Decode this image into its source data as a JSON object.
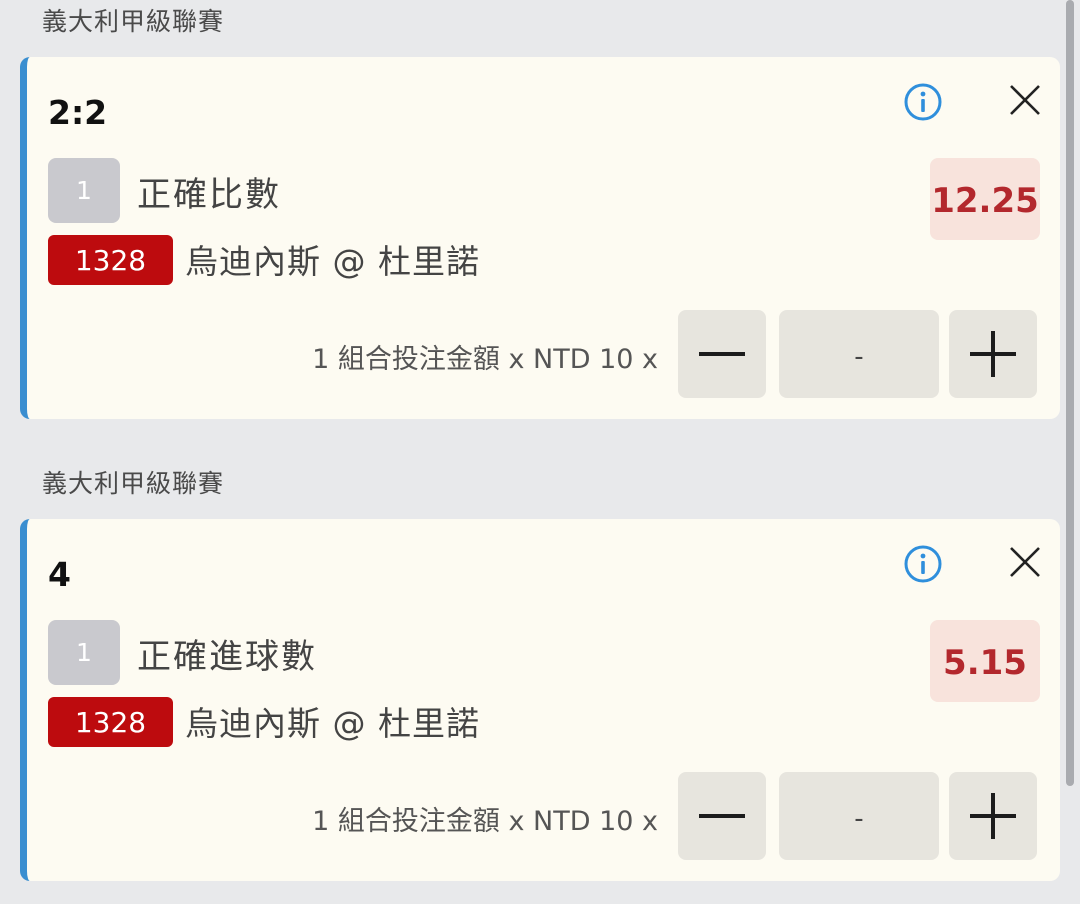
{
  "bets": [
    {
      "league": "義大利甲級聯賽",
      "selection": "2:2",
      "leg_number": "1",
      "market": "正確比數",
      "odds": "12.25",
      "match_code": "1328",
      "match": "烏迪內斯 @ 杜里諾",
      "stake_label": "1 組合投注金額 x NTD 10 x",
      "stake_value": "-"
    },
    {
      "league": "義大利甲級聯賽",
      "selection": "4",
      "leg_number": "1",
      "market": "正確進球數",
      "odds": "5.15",
      "match_code": "1328",
      "match": "烏迪內斯 @ 杜里諾",
      "stake_label": "1 組合投注金額 x NTD 10 x",
      "stake_value": "-"
    }
  ],
  "icons": {
    "info": "info-icon",
    "close": "close-icon",
    "minus": "minus-icon",
    "plus": "plus-icon"
  },
  "colors": {
    "accent_bar": "#3a8ed0",
    "card_bg": "#fdfbf2",
    "odds_text": "#b3282d",
    "odds_bg": "#f8e3dc",
    "match_code_bg": "#bd0b0e",
    "info_icon": "#2f8fdc"
  }
}
